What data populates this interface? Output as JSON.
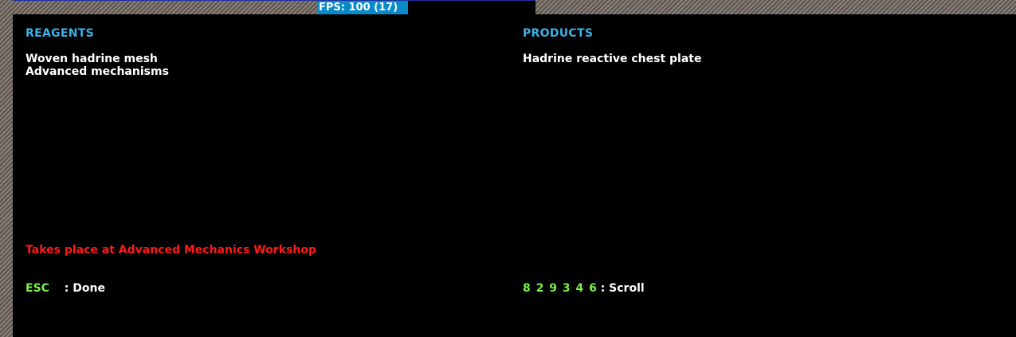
{
  "fps_counter": "FPS: 100 (17)",
  "reagents": {
    "heading": "REAGENTS",
    "items": [
      "Woven hadrine mesh",
      "Advanced mechanisms"
    ]
  },
  "products": {
    "heading": "PRODUCTS",
    "items": [
      "Hadrine reactive chest plate"
    ]
  },
  "location_text": "Takes place at Advanced Mechanics Workshop",
  "hints": {
    "done_key": "ESC",
    "done_label": ": Done",
    "scroll_keys": "8 2 9 3 4 6",
    "scroll_label": ": Scroll"
  },
  "colors": {
    "heading": "#3cb0e8",
    "location": "#ff1a1a",
    "hotkey": "#7cf04a",
    "fps_bar": "#0a8bc8"
  }
}
